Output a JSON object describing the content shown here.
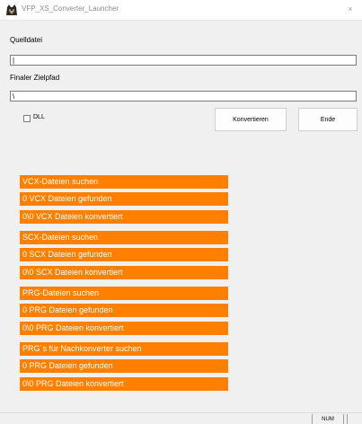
{
  "window": {
    "title": "VFP_XS_Converter_Launcher",
    "close_glyph": "×"
  },
  "form": {
    "source_label": "Quelldatei",
    "source_value": "|",
    "target_label": "Finaler Zielpfad",
    "target_value": "\\",
    "dll_label": "DLL",
    "dll_checked": false,
    "convert_button": "Konvertieren",
    "end_button": "Ende"
  },
  "statuses": {
    "vcx": [
      "VCX-Dateien suchen",
      "0 VCX Dateien gefunden",
      "0\\0 VCX Dateien konvertiert"
    ],
    "scx": [
      "SCX-Dateien suchen",
      "0 SCX Dateien gefunden",
      "0\\0 SCX Dateien konvertiert"
    ],
    "prg": [
      "PRG-Dateien suchen",
      "0 PRG Dateien gefunden",
      "0\\0 PRG Dateien konvertiert"
    ],
    "post": [
      "PRG´s für Nachkonverter suchen",
      "0 PRG Dateien gefunden",
      "0\\0 PRG Dateien konvertiert"
    ]
  },
  "statusbar": {
    "num": "NUM"
  },
  "colors": {
    "accent": "#ff8000"
  },
  "icons": {
    "app": "fox-head-icon"
  }
}
